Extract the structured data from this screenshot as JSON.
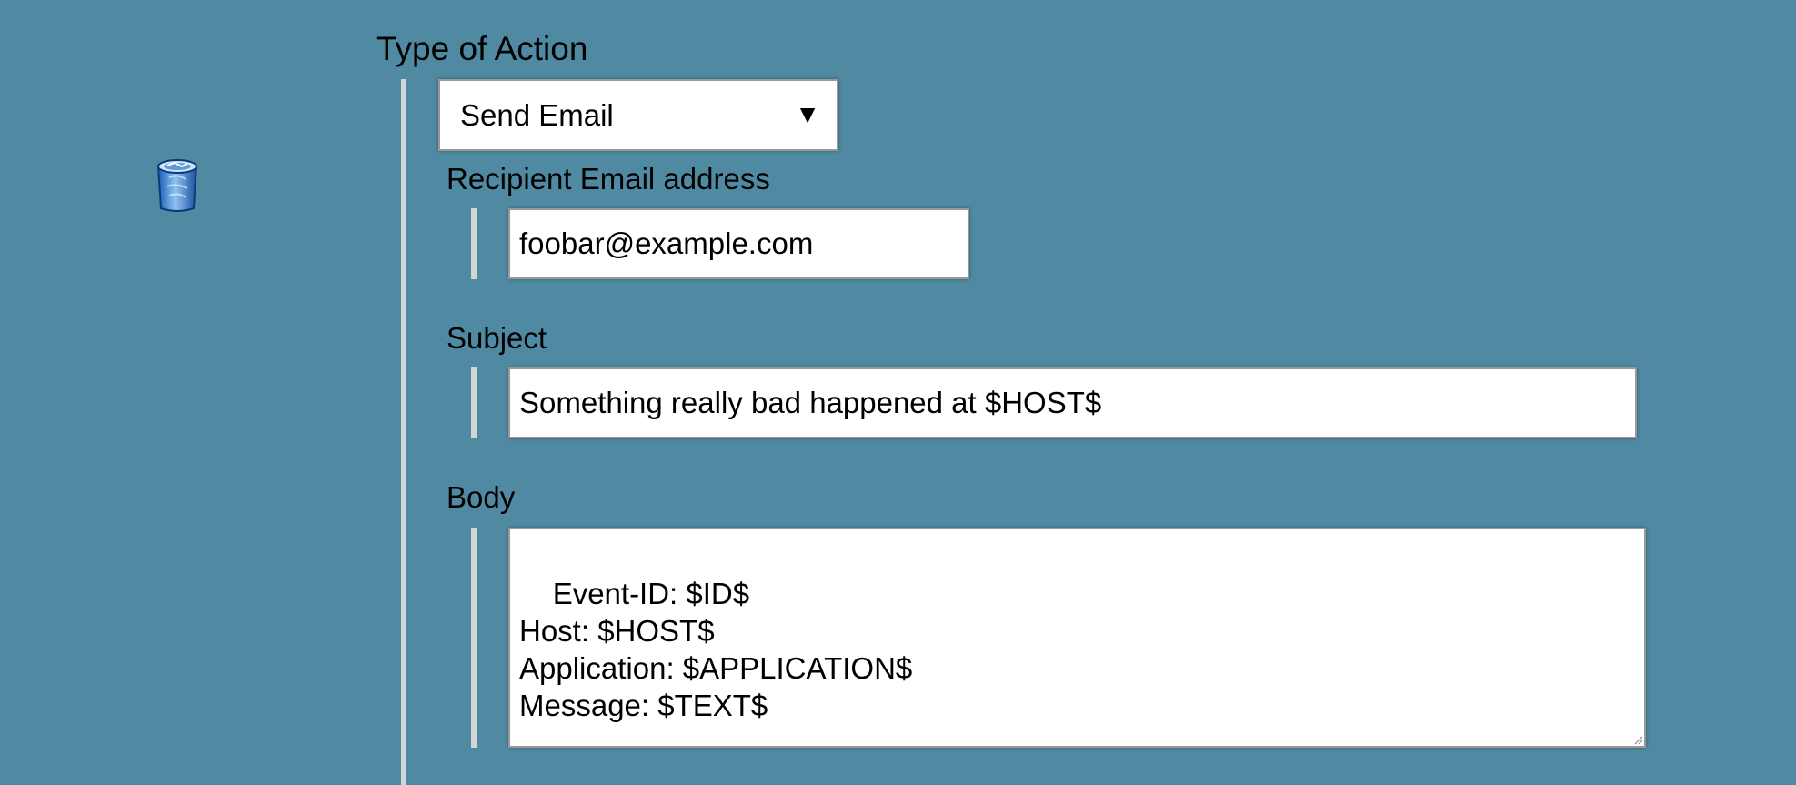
{
  "delete_icon": "trash-icon",
  "action": {
    "title": "Type of Action",
    "selected": "Send Email",
    "arrow": "▼"
  },
  "recipient": {
    "label": "Recipient Email address",
    "value": "foobar@example.com"
  },
  "subject": {
    "label": "Subject",
    "value": "Something really bad happened at $HOST$"
  },
  "body": {
    "label": "Body",
    "value": "Event-ID: $ID$\nHost: $HOST$\nApplication: $APPLICATION$\nMessage: $TEXT$"
  },
  "colors": {
    "background": "#508aa2",
    "field_bar": "#d4d4d4",
    "field_background": "#ffffff"
  }
}
